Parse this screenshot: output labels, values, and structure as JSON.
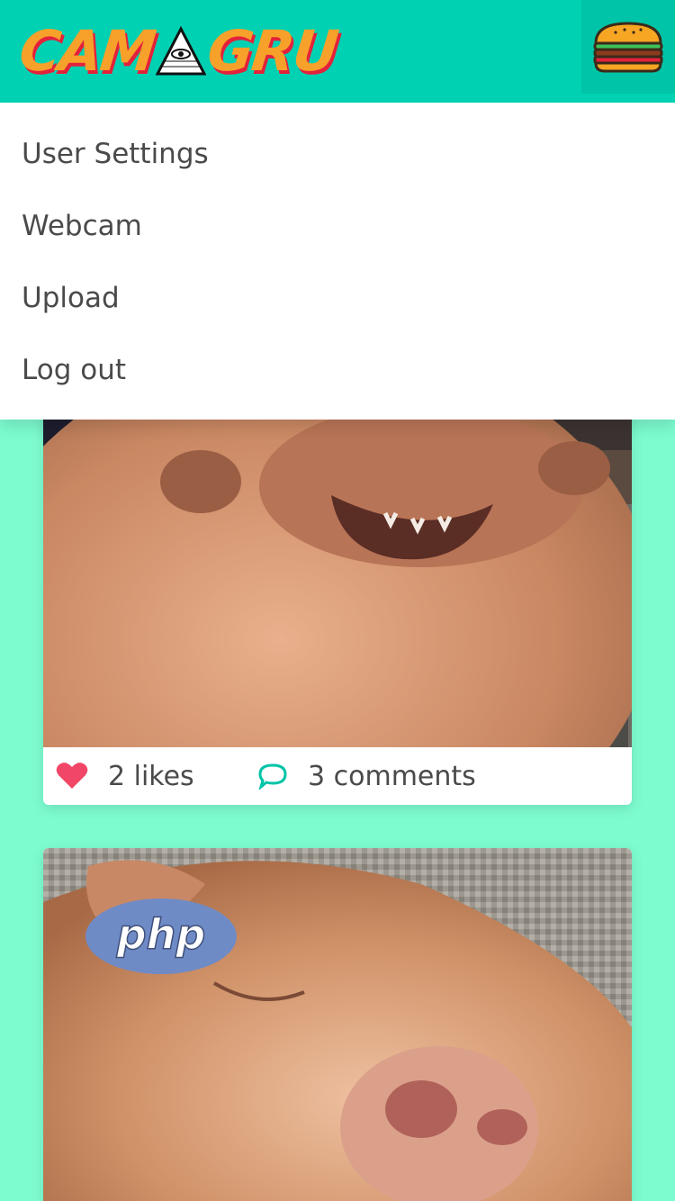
{
  "app": {
    "logo_text_left": "CAM",
    "logo_text_right": "GRU",
    "brand_color": "#00d1b2",
    "background_color": "#7dfcd0"
  },
  "navbar": {
    "menu_icon": "hamburger-burger-icon"
  },
  "menu": {
    "items": [
      {
        "label": "User Settings"
      },
      {
        "label": "Webcam"
      },
      {
        "label": "Upload"
      },
      {
        "label": "Log out"
      }
    ]
  },
  "posts": [
    {
      "image": "dog-photo-closeup-icon",
      "likes_text": "2 likes",
      "comments_text": "3 comments",
      "like_icon": "heart-icon",
      "comment_icon": "comment-bubble-icon"
    },
    {
      "image": "dog-photo-with-php-sticker-icon",
      "sticker_text": "php"
    }
  ]
}
